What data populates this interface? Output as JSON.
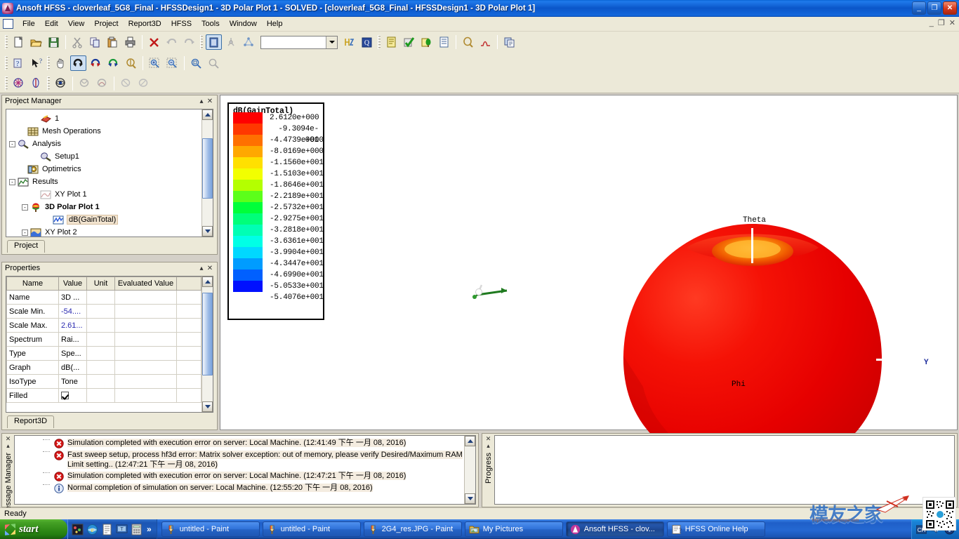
{
  "window": {
    "title": "Ansoft HFSS  - cloverleaf_5G8_Final - HFSSDesign1 - 3D Polar Plot 1 - SOLVED - [cloverleaf_5G8_Final - HFSSDesign1 - 3D Polar Plot 1]",
    "app_icon": "ansoft-icon",
    "minimize": "_",
    "maximize": "❐",
    "close": "✕",
    "mdi_minimize": "_",
    "mdi_restore": "❐",
    "mdi_close": "✕"
  },
  "menu": {
    "items": [
      {
        "label": "File"
      },
      {
        "label": "Edit"
      },
      {
        "label": "View"
      },
      {
        "label": "Project"
      },
      {
        "label": "Report3D"
      },
      {
        "label": "HFSS"
      },
      {
        "label": "Tools"
      },
      {
        "label": "Window"
      },
      {
        "label": "Help"
      }
    ]
  },
  "toolbars": {
    "row1": [
      {
        "icon": "new-document-icon"
      },
      {
        "icon": "open-folder-icon"
      },
      {
        "icon": "save-icon"
      },
      {
        "sep": true
      },
      {
        "icon": "cut-scissors-icon"
      },
      {
        "icon": "copy-icon"
      },
      {
        "icon": "paste-icon"
      },
      {
        "icon": "print-icon"
      },
      {
        "sep": true
      },
      {
        "icon": "delete-x-icon"
      },
      {
        "icon": "undo-icon"
      },
      {
        "icon": "redo-icon"
      },
      {
        "grip": true
      },
      {
        "icon": "select-object-icon",
        "active": true
      },
      {
        "icon": "select-face-icon"
      },
      {
        "icon": "select-edge-icon"
      },
      {
        "combo": true
      },
      {
        "icon": "variables-icon"
      },
      {
        "sep": true
      },
      {
        "icon": "design-settings-icon"
      },
      {
        "grip": true
      },
      {
        "icon": "validation-icon"
      },
      {
        "icon": "analyze-all-icon"
      },
      {
        "icon": "analyze-icon"
      },
      {
        "icon": "report-icon"
      },
      {
        "sep": true
      },
      {
        "icon": "field-overlay-icon"
      },
      {
        "icon": "plot-curve-icon"
      },
      {
        "sep": true
      },
      {
        "icon": "copy-image-icon"
      }
    ],
    "row2": [
      {
        "icon": "help-context-icon"
      },
      {
        "icon": "whats-this-icon"
      },
      {
        "grip": true
      },
      {
        "icon": "pan-hand-icon"
      },
      {
        "icon": "rotate-icon",
        "active": true
      },
      {
        "icon": "rotate-x-icon"
      },
      {
        "icon": "rotate-y-icon"
      },
      {
        "icon": "spin-icon"
      },
      {
        "sep": true
      },
      {
        "icon": "zoom-in-dashed-icon"
      },
      {
        "icon": "zoom-out-dashed-icon"
      },
      {
        "sep": true
      },
      {
        "icon": "fit-all-icon"
      },
      {
        "icon": "fit-selection-icon"
      }
    ],
    "row3": [
      {
        "icon": "mesh-plot-icon"
      },
      {
        "icon": "field-plot-icon"
      },
      {
        "grip": true
      },
      {
        "icon": "animate-icon"
      },
      {
        "sep": true
      },
      {
        "icon": "marker-icon"
      },
      {
        "icon": "marker2-icon"
      },
      {
        "sep": true
      },
      {
        "icon": "clear-marker-icon"
      },
      {
        "icon": "clear-all-markers-icon"
      }
    ],
    "combo_value": "",
    "combo_placeholder": ""
  },
  "project_manager": {
    "caption": "Project Manager",
    "collapse_btn": "▴",
    "close_btn": "✕",
    "tab": "Project",
    "tree": [
      {
        "label": "1",
        "indent": 72,
        "icon": "boundary-icon",
        "expander": "",
        "bold": false,
        "selected": false
      },
      {
        "label": "Mesh Operations",
        "indent": 54,
        "icon": "mesh-operations-icon",
        "expander": "",
        "bold": false,
        "selected": false
      },
      {
        "label": "Analysis",
        "indent": 40,
        "icon": "analysis-icon",
        "expander": "-",
        "bold": false,
        "selected": false
      },
      {
        "label": "Setup1",
        "indent": 72,
        "icon": "setup-icon",
        "expander": "",
        "bold": false,
        "selected": false
      },
      {
        "label": "Optimetrics",
        "indent": 54,
        "icon": "optimetrics-icon",
        "expander": "",
        "bold": false,
        "selected": false
      },
      {
        "label": "Results",
        "indent": 40,
        "icon": "results-icon",
        "expander": "-",
        "bold": false,
        "selected": false
      },
      {
        "label": "XY Plot 1",
        "indent": 72,
        "icon": "xy-plot-icon",
        "expander": "",
        "bold": false,
        "selected": false
      },
      {
        "label": "3D Polar Plot 1",
        "indent": 58,
        "icon": "polar-plot-icon",
        "expander": "-",
        "bold": true,
        "selected": false
      },
      {
        "label": "dB(GainTotal)",
        "indent": 90,
        "icon": "trace-icon",
        "expander": "",
        "bold": false,
        "selected": true
      },
      {
        "label": "XY Plot 2",
        "indent": 58,
        "icon": "xy-plot2-icon",
        "expander": "-",
        "bold": false,
        "selected": false
      }
    ]
  },
  "properties": {
    "caption": "Properties",
    "collapse_btn": "▴",
    "close_btn": "✕",
    "tab": "Report3D",
    "columns": [
      "Name",
      "Value",
      "Unit",
      "Evaluated Value",
      ""
    ],
    "rows": [
      {
        "name": "Name",
        "value": "3D ...",
        "unit": "",
        "evaluated": "",
        "blue": false,
        "checkbox": false
      },
      {
        "name": "Scale Min.",
        "value": "-54....",
        "unit": "",
        "evaluated": "",
        "blue": true,
        "checkbox": false
      },
      {
        "name": "Scale Max.",
        "value": "2.61...",
        "unit": "",
        "evaluated": "",
        "blue": true,
        "checkbox": false
      },
      {
        "name": "Spectrum",
        "value": "Rai...",
        "unit": "",
        "evaluated": "",
        "blue": false,
        "checkbox": false
      },
      {
        "name": "Type",
        "value": "Spe...",
        "unit": "",
        "evaluated": "",
        "blue": false,
        "checkbox": false
      },
      {
        "name": "Graph",
        "value": "dB(...",
        "unit": "",
        "evaluated": "",
        "blue": false,
        "checkbox": false
      },
      {
        "name": "IsoType",
        "value": "Tone",
        "unit": "",
        "evaluated": "",
        "blue": false,
        "checkbox": false
      },
      {
        "name": "Filled",
        "value": "",
        "unit": "",
        "evaluated": "",
        "blue": false,
        "checkbox": true
      }
    ]
  },
  "plot": {
    "legend_title": "dB(GainTotal)",
    "legend_values": [
      "2.6120e+000",
      "-9.3094e-001",
      "-4.4739e+000",
      "-8.0169e+000",
      "-1.1560e+001",
      "-1.5103e+001",
      "-1.8646e+001",
      "-2.2189e+001",
      "-2.5732e+001",
      "-2.9275e+001",
      "-3.2818e+001",
      "-3.6361e+001",
      "-3.9904e+001",
      "-4.3447e+001",
      "-4.6990e+001",
      "-5.0533e+001",
      "-5.4076e+001"
    ],
    "legend_colors": [
      "#ff0000",
      "#ff3800",
      "#ff7000",
      "#ffa800",
      "#ffe000",
      "#f2ff00",
      "#b4ff00",
      "#5cff1a",
      "#00ff3a",
      "#00ff7a",
      "#00ffb4",
      "#00ffe6",
      "#00d8ff",
      "#009cff",
      "#0060ff",
      "#0010ff"
    ],
    "axis_labels": {
      "theta": "Theta",
      "phi": "Phi",
      "y": "Y"
    },
    "y_label_color": "#1c2b9c",
    "surface_color_main": "#e00000",
    "surface_color_top": "#ff9b10"
  },
  "message_manager": {
    "caption": "Message Manager",
    "close_btn": "✕",
    "collapse_btn": "▴",
    "messages": [
      {
        "type": "error",
        "text": "Simulation completed with execution error on server: Local Machine. (12:41:49 下午  一月  08, 2016)"
      },
      {
        "type": "error",
        "text": "Fast sweep setup, process hf3d error: Matrix solver exception: out of memory, please verify Desired/Maximum RAM Limit setting.. (12:47:21 下午  一月  08, 2016)"
      },
      {
        "type": "error",
        "text": "Simulation completed with execution error on server: Local Machine. (12:47:21 下午  一月  08, 2016)"
      },
      {
        "type": "info",
        "text": "Normal completion of simulation on server: Local Machine. (12:55:20 下午  一月  08, 2016)"
      }
    ]
  },
  "progress_panel": {
    "caption": "Progress",
    "close_btn": "✕",
    "collapse_btn": "▴"
  },
  "status_bar": {
    "text": "Ready"
  },
  "taskbar": {
    "start_label": "start",
    "quick_launch": [
      {
        "icon": "media-player-icon"
      },
      {
        "icon": "ie-browser-icon"
      },
      {
        "icon": "notepad-icon"
      },
      {
        "icon": "show-desktop-icon"
      },
      {
        "icon": "calculator-icon"
      }
    ],
    "overflow": "»",
    "buttons": [
      {
        "label": "untitled - Paint",
        "icon": "paint-icon",
        "active": false
      },
      {
        "label": "untitled - Paint",
        "icon": "paint-icon",
        "active": false
      },
      {
        "label": "2G4_res.JPG - Paint",
        "icon": "paint-icon",
        "active": false
      },
      {
        "label": "My Pictures",
        "icon": "folder-pictures-icon",
        "active": false
      },
      {
        "label": "Ansoft HFSS  - clov...",
        "icon": "ansoft-icon",
        "active": true
      },
      {
        "label": "HFSS Online Help",
        "icon": "help-book-icon",
        "active": false
      }
    ],
    "tray": [
      {
        "icon": "language-bar-cn-icon",
        "label": "CH"
      },
      {
        "icon": "volume-icon"
      },
      {
        "icon": "network-icon"
      }
    ]
  },
  "watermark": {
    "text": "模友之家",
    "url": "http://www.moyoujia.com",
    "qr": "qr-code-icon"
  }
}
